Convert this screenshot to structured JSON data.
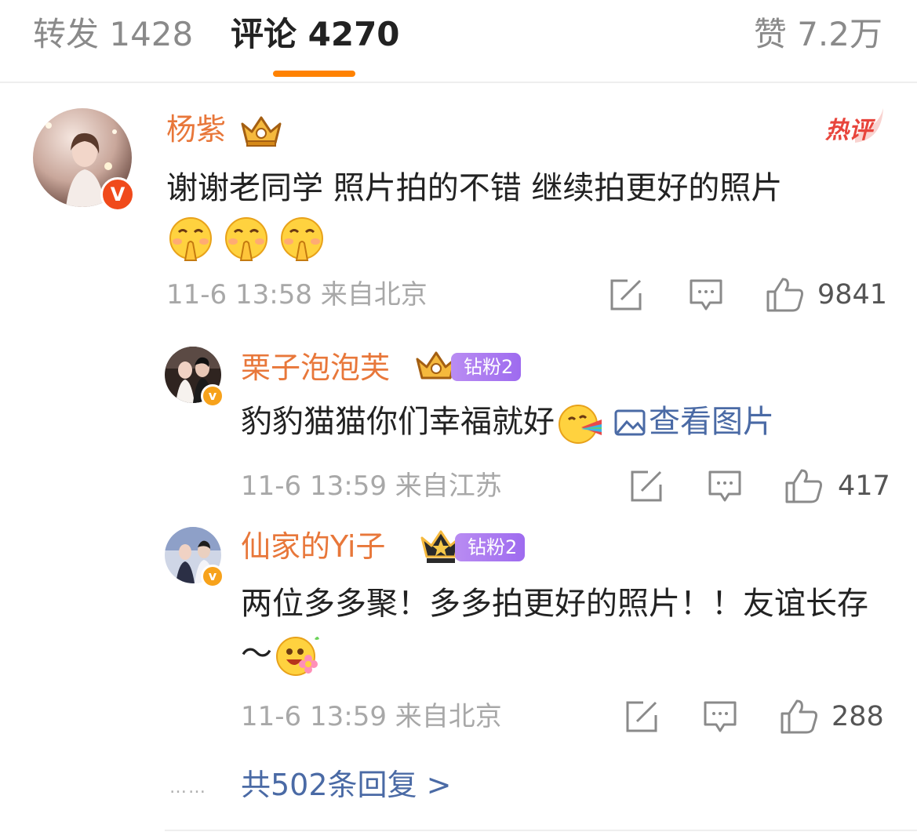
{
  "tabs": {
    "repost": "转发 1428",
    "comments": "评论 4270",
    "likes": "赞 7.2万"
  },
  "colors": {
    "accent": "#ff8200",
    "username": "#e8773a",
    "link": "#4a6aa5",
    "meta": "#a8a8a8",
    "fan_badge": "#a675f0",
    "hot_tag": "#e8453c"
  },
  "comments": [
    {
      "username": "杨紫",
      "text": "谢谢老同学 照片拍的不错 继续拍更好的照片",
      "emojis": [
        "hands-together-emoji",
        "hands-together-emoji",
        "hands-together-emoji"
      ],
      "time": "11-6 13:58 来自北京",
      "likes": "9841",
      "hot_tag": "热评",
      "verified_badge": "V",
      "crown_icon": "crown-icon"
    },
    {
      "username": "栗子泡泡芙",
      "fan_badge": "钻粉2",
      "text": "豹豹猫猫你们幸福就好",
      "emoji": "rainbow-vomit-emoji",
      "image_link": "查看图片",
      "time": "11-6 13:59 来自江苏",
      "likes": "417",
      "verified_badge": "v"
    },
    {
      "username": "仙家的Yi子",
      "fan_badge": "钻粉2",
      "text": "两位多多聚！多多拍更好的照片！！友谊长存～",
      "emoji": "flower-smile-emoji",
      "time": "11-6 13:59 来自北京",
      "likes": "288",
      "verified_badge": "v"
    }
  ],
  "replies": {
    "dots": "……",
    "link": "共502条回复 >"
  },
  "icons": {
    "share": "share-icon",
    "reply": "comment-icon",
    "like": "thumbs-up-icon",
    "view_image": "image-icon"
  }
}
